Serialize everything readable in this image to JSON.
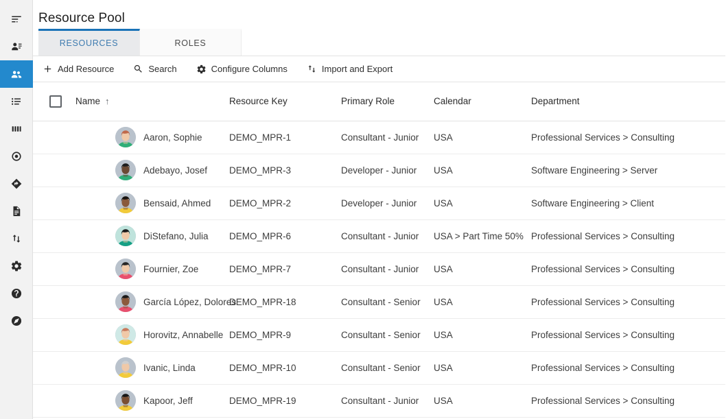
{
  "sidebar": {
    "items": [
      {
        "name": "menu-collapse-icon",
        "icon": "menu-align-left",
        "label": "Menu",
        "active": false
      },
      {
        "name": "my-profile-icon",
        "icon": "person-lines",
        "label": "My Profile",
        "active": false
      },
      {
        "name": "resource-pool-icon",
        "icon": "people",
        "label": "Resource Pool",
        "active": true
      },
      {
        "name": "list-icon",
        "icon": "list",
        "label": "Lists",
        "active": false
      },
      {
        "name": "columns-icon",
        "icon": "columns",
        "label": "Board",
        "active": false
      },
      {
        "name": "target-icon",
        "icon": "target",
        "label": "Goals",
        "active": false
      },
      {
        "name": "diamond-arrow-icon",
        "icon": "diamond-arrow",
        "label": "Routing",
        "active": false
      },
      {
        "name": "document-icon",
        "icon": "document",
        "label": "Documents",
        "active": false
      },
      {
        "name": "transfer-icon",
        "icon": "arrows-up-down",
        "label": "Transfer",
        "active": false
      },
      {
        "name": "settings-gear-icon",
        "icon": "gear",
        "label": "Settings",
        "active": false
      },
      {
        "name": "help-icon",
        "icon": "question-circle",
        "label": "Help",
        "active": false
      },
      {
        "name": "compass-icon",
        "icon": "compass",
        "label": "Explore",
        "active": false
      }
    ]
  },
  "header": {
    "title": "Resource Pool"
  },
  "tabs": [
    {
      "label": "RESOURCES",
      "active": true
    },
    {
      "label": "ROLES",
      "active": false
    }
  ],
  "toolbar": {
    "buttons": [
      {
        "label": "Add Resource",
        "icon": "plus-icon"
      },
      {
        "label": "Search",
        "icon": "search-icon"
      },
      {
        "label": "Configure Columns",
        "icon": "gear-icon"
      },
      {
        "label": "Import and Export",
        "icon": "import-export-icon"
      }
    ]
  },
  "table": {
    "select_all_checked": false,
    "sort_column": "Name",
    "sort_direction": "asc",
    "sort_glyph": "↑",
    "columns": [
      {
        "key": "name",
        "label": "Name"
      },
      {
        "key": "key",
        "label": "Resource Key"
      },
      {
        "key": "role",
        "label": "Primary Role"
      },
      {
        "key": "calendar",
        "label": "Calendar"
      },
      {
        "key": "dept",
        "label": "Department"
      }
    ],
    "rows": [
      {
        "name": "Aaron, Sophie",
        "key": "DEMO_MPR-1",
        "role": "Consultant - Junior",
        "calendar": "USA",
        "dept": "Professional Services > Consulting",
        "avatar": {
          "skin": "#f0c9a8",
          "hair": "#c0694a",
          "shirt": "#2fae78",
          "bg": "#b9c2cc"
        }
      },
      {
        "name": "Adebayo, Josef",
        "key": "DEMO_MPR-3",
        "role": "Developer - Junior",
        "calendar": "USA",
        "dept": "Software Engineering > Server",
        "avatar": {
          "skin": "#6b4a33",
          "hair": "#1d1d1d",
          "shirt": "#2fae78",
          "bg": "#b9c2cc"
        }
      },
      {
        "name": "Bensaid, Ahmed",
        "key": "DEMO_MPR-2",
        "role": "Developer - Junior",
        "calendar": "USA",
        "dept": "Software Engineering > Client",
        "avatar": {
          "skin": "#8a5a3b",
          "hair": "#17120f",
          "shirt": "#f2cb3a",
          "bg": "#b9c2cc"
        }
      },
      {
        "name": "DiStefano, Julia",
        "key": "DEMO_MPR-6",
        "role": "Consultant - Junior",
        "calendar": "USA > Part Time 50%",
        "dept": "Professional Services > Consulting",
        "avatar": {
          "skin": "#f0c9a8",
          "hair": "#1b1b1b",
          "shirt": "#16a085",
          "bg": "#bfe3dc"
        }
      },
      {
        "name": "Fournier, Zoe",
        "key": "DEMO_MPR-7",
        "role": "Consultant - Junior",
        "calendar": "USA",
        "dept": "Professional Services > Consulting",
        "avatar": {
          "skin": "#f0c9a8",
          "hair": "#262626",
          "shirt": "#e8506e",
          "bg": "#b9c2cc"
        }
      },
      {
        "name": "García López, Dolores",
        "key": "DEMO_MPR-18",
        "role": "Consultant - Senior",
        "calendar": "USA",
        "dept": "Professional Services > Consulting",
        "avatar": {
          "skin": "#8c5a3c",
          "hair": "#1a1a1a",
          "shirt": "#e8506e",
          "bg": "#b9c2cc"
        }
      },
      {
        "name": "Horovitz, Annabelle",
        "key": "DEMO_MPR-9",
        "role": "Consultant - Senior",
        "calendar": "USA",
        "dept": "Professional Services > Consulting",
        "avatar": {
          "skin": "#f0c9a8",
          "hair": "#c97b5e",
          "shirt": "#f2cb3a",
          "bg": "#cfe9e6"
        }
      },
      {
        "name": "Ivanic, Linda",
        "key": "DEMO_MPR-10",
        "role": "Consultant - Senior",
        "calendar": "USA",
        "dept": "Professional Services > Consulting",
        "avatar": {
          "skin": "#f0c9a8",
          "hair": "#cfcfcf",
          "shirt": "#f2cb3a",
          "bg": "#b9c2cc"
        }
      },
      {
        "name": "Kapoor, Jeff",
        "key": "DEMO_MPR-19",
        "role": "Consultant - Junior",
        "calendar": "USA",
        "dept": "Professional Services > Consulting",
        "avatar": {
          "skin": "#7a4f33",
          "hair": "#161616",
          "shirt": "#f2cb3a",
          "bg": "#b9c2cc"
        }
      }
    ]
  },
  "colors": {
    "accent": "#2389cd",
    "tab_active_text": "#3f7cb0",
    "tab_active_border": "#1a73b7",
    "rail_bg": "#f2f2f2",
    "text": "#3c3c3c"
  }
}
